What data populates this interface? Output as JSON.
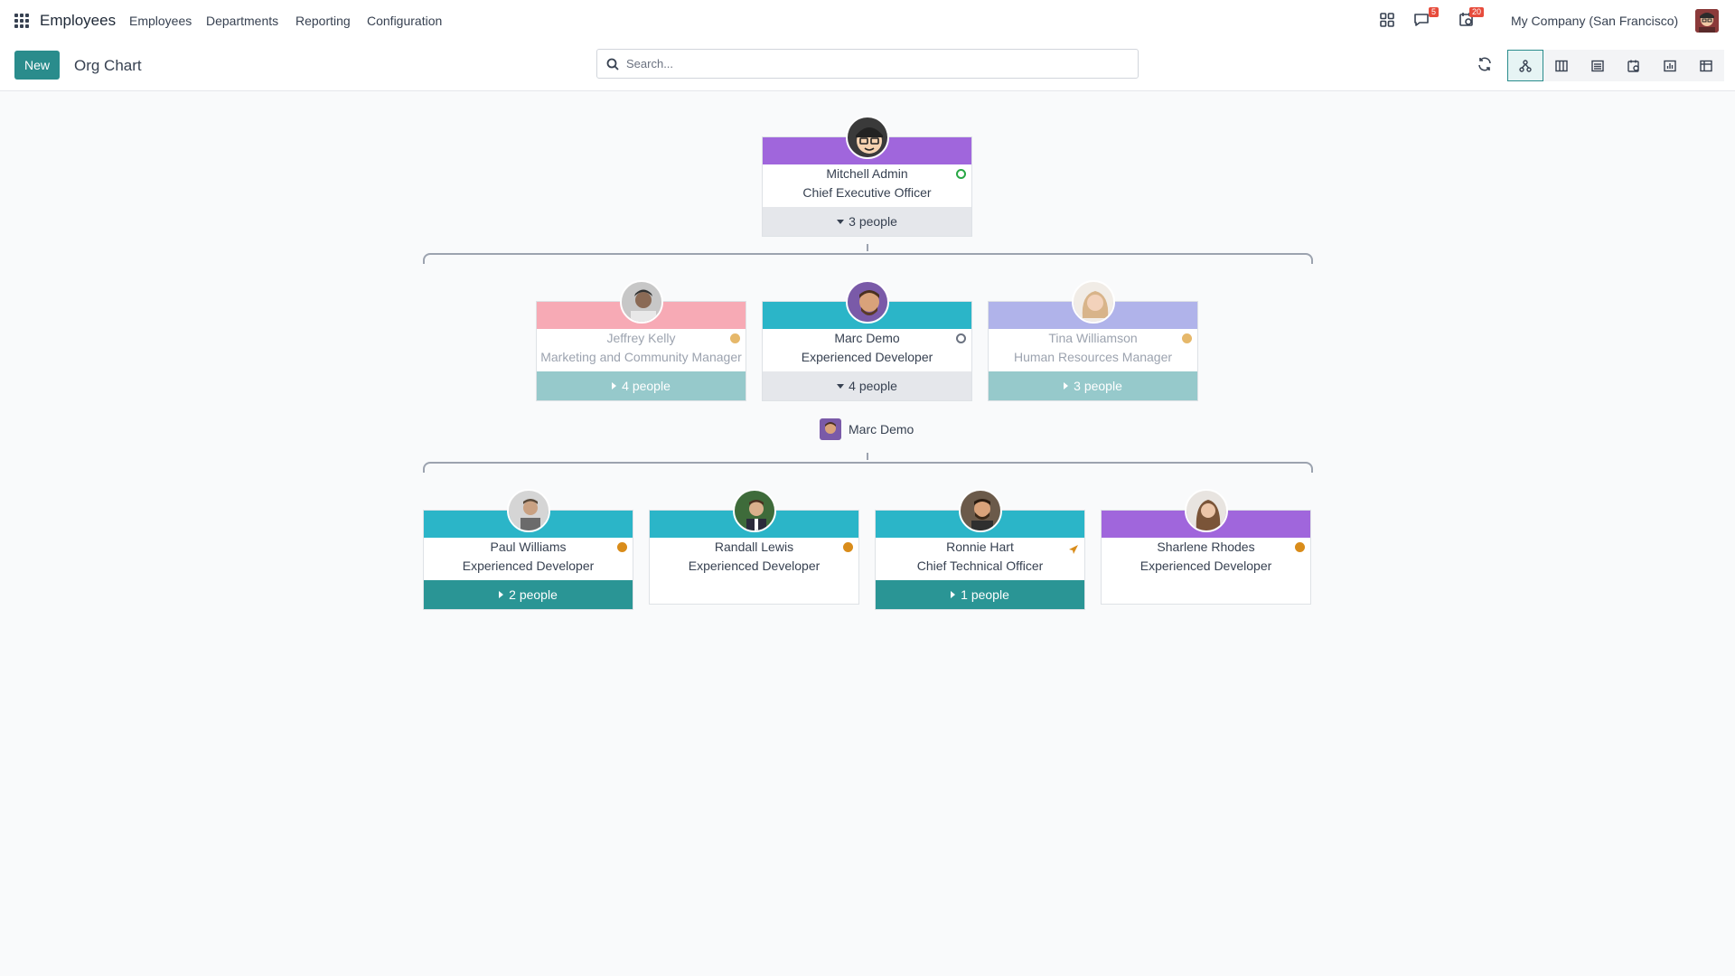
{
  "navbar": {
    "app_name": "Employees",
    "menu": [
      "Employees",
      "Departments",
      "Reporting",
      "Configuration"
    ],
    "messages_badge": "5",
    "activities_badge": "20",
    "company": "My Company (San Francisco)"
  },
  "control_panel": {
    "new_label": "New",
    "breadcrumb": "Org Chart",
    "search_placeholder": "Search..."
  },
  "org_chart": {
    "root": {
      "name": "Mitchell Admin",
      "job": "Chief Executive Officer",
      "footer": "3 people",
      "header_color": "#a066dc",
      "status": "online"
    },
    "level1": [
      {
        "name": "Jeffrey Kelly",
        "job": "Marketing and Community Manager",
        "footer": "4 people",
        "header_color": "#f7aab5",
        "status": "away"
      },
      {
        "name": "Marc Demo",
        "job": "Experienced Developer",
        "footer": "4 people",
        "header_color": "#2bb5c8",
        "status": "offline"
      },
      {
        "name": "Tina Williamson",
        "job": "Human Resources Manager",
        "footer": "3 people",
        "header_color": "#b0b3ea",
        "status": "away"
      }
    ],
    "expanded_manager": "Marc Demo",
    "level2": [
      {
        "name": "Paul Williams",
        "job": "Experienced Developer",
        "footer": "2 people",
        "header_color": "#2bb5c8",
        "status": "away"
      },
      {
        "name": "Randall Lewis",
        "job": "Experienced Developer",
        "footer": "",
        "header_color": "#2bb5c8",
        "status": "away"
      },
      {
        "name": "Ronnie Hart",
        "job": "Chief Technical Officer",
        "footer": "1 people",
        "header_color": "#2bb5c8",
        "status": "time-off"
      },
      {
        "name": "Sharlene Rhodes",
        "job": "Experienced Developer",
        "footer": "",
        "header_color": "#a066dc",
        "status": "away"
      }
    ]
  }
}
